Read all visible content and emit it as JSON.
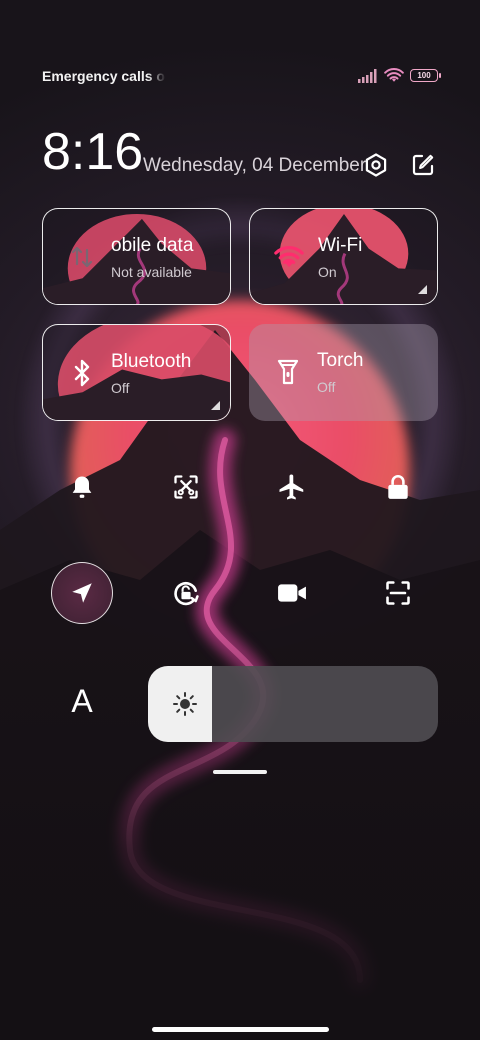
{
  "status_bar": {
    "carrier_text": "Emergency calls o",
    "battery_level": "100",
    "signal_icon": "signal-bars-icon",
    "wifi_icon": "wifi-icon"
  },
  "header": {
    "time": "8:16",
    "date": "Wednesday, 04 December",
    "settings_icon": "settings-hexagon-icon",
    "edit_icon": "edit-icon"
  },
  "tiles": [
    {
      "label": "obile data",
      "sub": "Not available",
      "icon": "mobile-data-icon"
    },
    {
      "label": "Wi-Fi",
      "sub": "On",
      "icon": "wifi-icon"
    },
    {
      "label": "Bluetooth",
      "sub": "Off",
      "icon": "bluetooth-icon"
    },
    {
      "label": "Torch",
      "sub": "Off",
      "icon": "flashlight-icon"
    }
  ],
  "toggles_row1": [
    "bell-icon",
    "screenshot-scissors-icon",
    "airplane-icon",
    "lock-icon"
  ],
  "toggles_row2": [
    "location-icon",
    "rotation-lock-icon",
    "video-camera-icon",
    "scan-icon"
  ],
  "brightness": {
    "auto_label": "A",
    "level": 0.22,
    "icon": "sun-icon"
  },
  "colors": {
    "accent_pink": "#e91e63",
    "tile_border": "#ffffff",
    "slider_fill": "#f0f0f0"
  }
}
